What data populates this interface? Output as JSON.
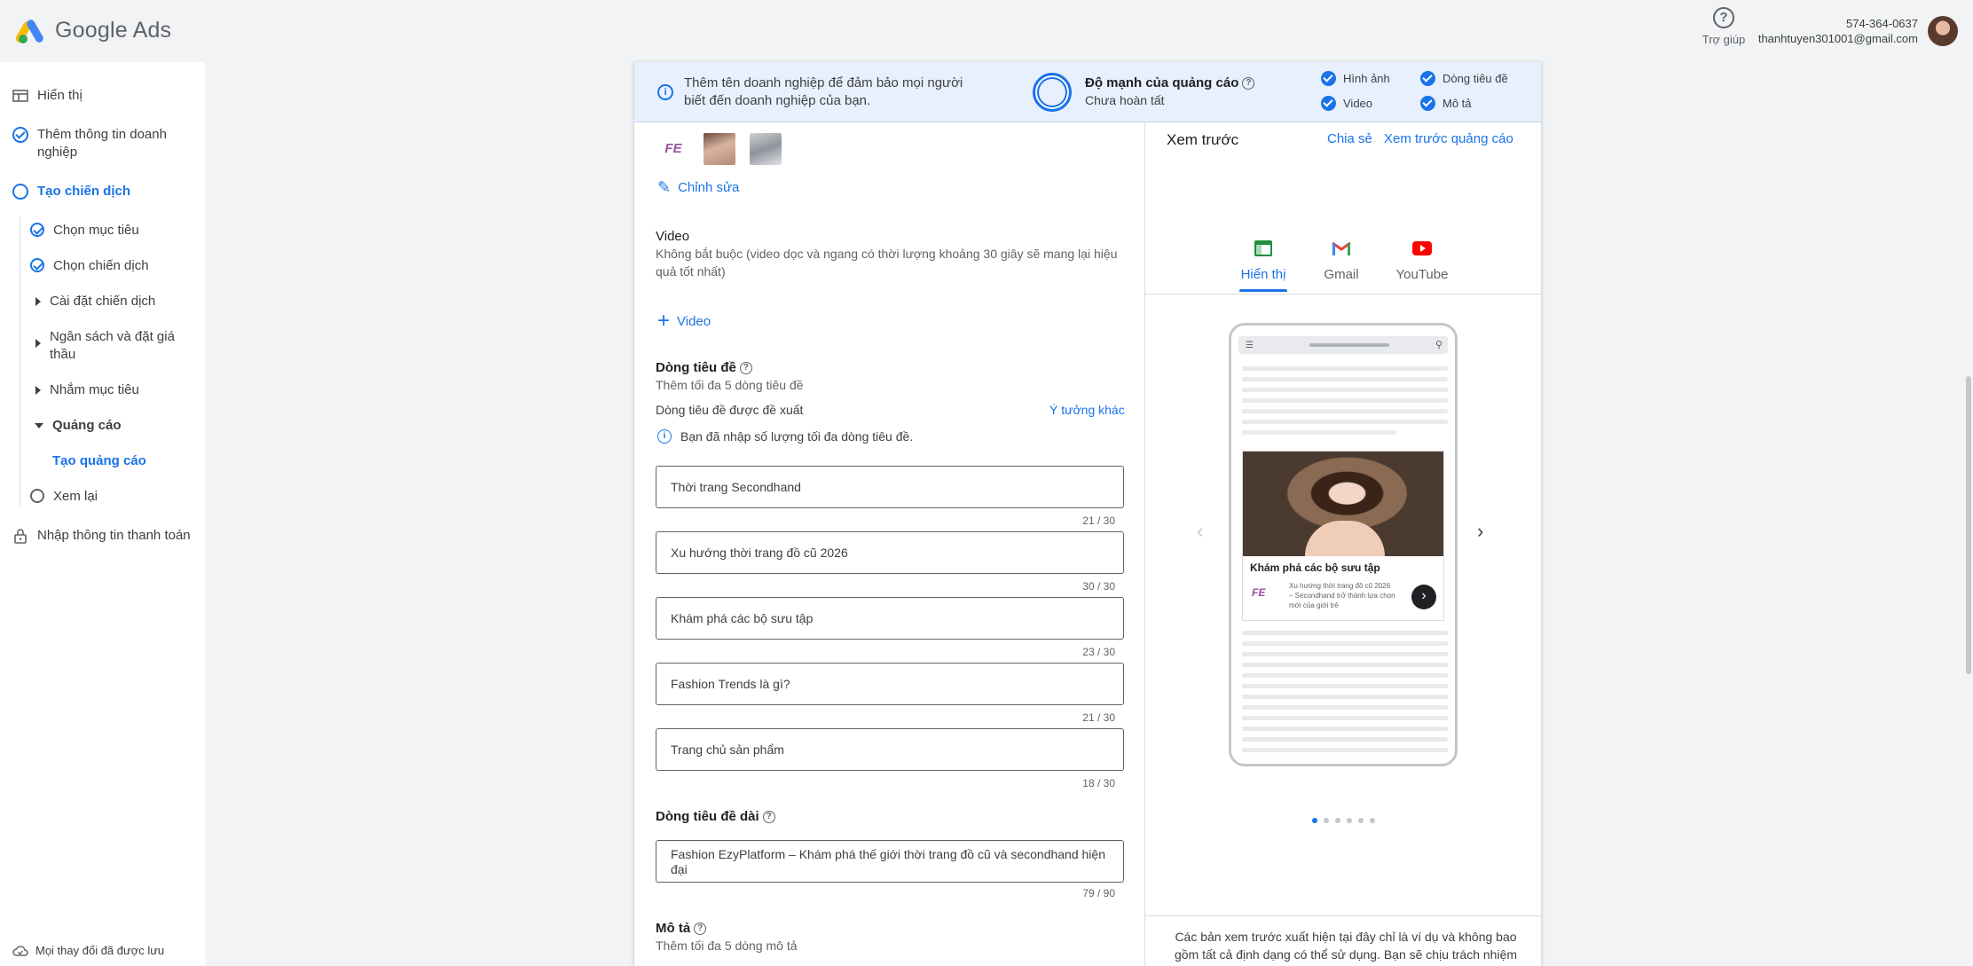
{
  "app": {
    "name": "Google Ads"
  },
  "header": {
    "help_label": "Trợ giúp",
    "phone": "574-364-0637",
    "email": "thanhtuyen301001@gmail.com"
  },
  "sidebar": {
    "items": [
      {
        "label": "Hiển thị"
      },
      {
        "label": "Thêm thông tin doanh nghiệp"
      },
      {
        "label": "Tạo chiến dịch"
      },
      {
        "label": "Chọn mục tiêu"
      },
      {
        "label": "Chọn chiến dịch"
      },
      {
        "label": "Cài đặt chiến dịch"
      },
      {
        "label": "Ngân sách và đặt giá thầu"
      },
      {
        "label": "Nhắm mục tiêu"
      },
      {
        "label": "Quảng cáo"
      },
      {
        "label": "Tạo quảng cáo"
      },
      {
        "label": "Xem lại"
      },
      {
        "label": "Nhập thông tin thanh toán"
      }
    ],
    "saved": "Mọi thay đổi đã được lưu"
  },
  "banner": {
    "message": "Thêm tên doanh nghiệp để đảm bảo mọi người biết đến doanh nghiệp của bạn.",
    "strength_title": "Độ mạnh của quảng cáo",
    "strength_status": "Chưa hoàn tất",
    "checks": [
      "Hình ảnh",
      "Dòng tiêu đề",
      "Video",
      "Mô tả"
    ]
  },
  "assets": {
    "logo_text": "FE",
    "edit_label": "Chỉnh sửa"
  },
  "video": {
    "title": "Video",
    "hint": "Không bắt buộc (video dọc và ngang có thời lượng khoảng 30 giây sẽ mang lại hiệu quả tốt nhất)",
    "add_label": "Video"
  },
  "headlines": {
    "title": "Dòng tiêu đề",
    "hint": "Thêm tối đa 5 dòng tiêu đề",
    "suggested": "Dòng tiêu đề được đề xuất",
    "more_ideas": "Ý tưởng khác",
    "max_note": "Bạn đã nhập số lượng tối đa dòng tiêu đề.",
    "items": [
      {
        "value": "Thời trang Secondhand",
        "count": "21 / 30"
      },
      {
        "value": " Xu hướng thời trang đồ cũ 2026",
        "count": "30 / 30"
      },
      {
        "value": "Khám phá các bộ sưu tập",
        "count": "23 / 30"
      },
      {
        "value": "Fashion Trends là gì?",
        "count": "21 / 30"
      },
      {
        "value": "Trang chủ sản phẩm",
        "count": "18 / 30"
      }
    ]
  },
  "long_headline": {
    "title": "Dòng tiêu đề dài",
    "value": "Fashion EzyPlatform – Khám phá thế giới thời trang đồ cũ và secondhand hiện đại",
    "count": "79 / 90"
  },
  "description": {
    "title": "Mô tả",
    "hint": "Thêm tối đa 5 dòng mô tả"
  },
  "preview": {
    "title": "Xem trước",
    "share": "Chia sẻ",
    "preview_ads": "Xem trước quảng cáo",
    "tabs": [
      "Hiển thị",
      "Gmail",
      "YouTube"
    ],
    "ad_headline": "Khám phá các bộ sưu tập",
    "ad_logo": "FE",
    "ad_description": "Xu hướng thời trang đồ cũ 2026 – Secondhand trở thành lựa chọn mới của giới trẻ",
    "slides_total": 6,
    "slide_active": 1,
    "disclaimer": "Các bản xem trước xuất hiện tại đây chỉ là ví dụ và không bao gồm tất cả định dạng có thể sử dụng. Bạn sẽ chịu trách nhiệm"
  },
  "colors": {
    "accent": "#1a73e8",
    "banner_bg": "#e8f0fe",
    "page_bg": "#f1f3f4"
  }
}
